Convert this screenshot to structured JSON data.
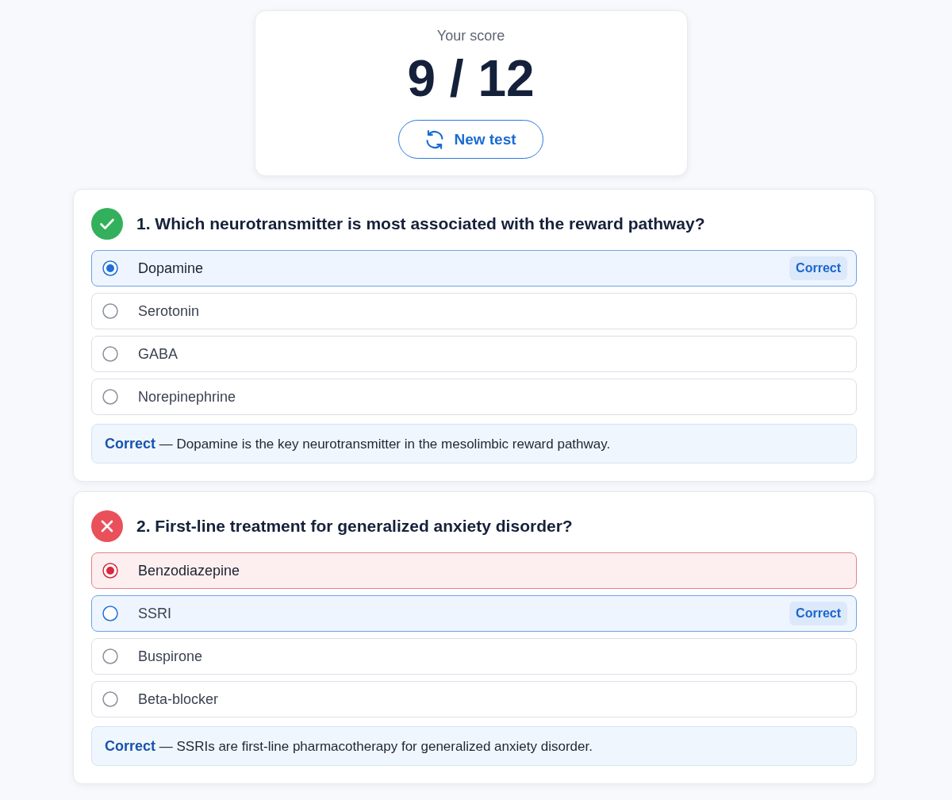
{
  "score": {
    "label": "Your score",
    "value": "9 / 12",
    "button": "New test"
  },
  "questions": [
    {
      "title": "1. Which neurotransmitter is most associated with the reward pathway?",
      "correct": true,
      "options": [
        {
          "label": "Dopamine",
          "selected": true,
          "correct": true,
          "tag": "Correct"
        },
        {
          "label": "Serotonin",
          "selected": false,
          "correct": false
        },
        {
          "label": "GABA",
          "selected": false,
          "correct": false
        },
        {
          "label": "Norepinephrine",
          "selected": false,
          "correct": false
        }
      ],
      "feedback": "**Correct** — Dopamine is the key neurotransmitter in the mesolimbic reward pathway."
    },
    {
      "title": "2. First-line treatment for generalized anxiety disorder?",
      "correct": false,
      "options": [
        {
          "label": "Benzodiazepine",
          "selected": true,
          "correct": false
        },
        {
          "label": "SSRI",
          "selected": false,
          "correct": true,
          "tag": "Correct"
        },
        {
          "label": "Buspirone",
          "selected": false,
          "correct": false
        },
        {
          "label": "Beta-blocker",
          "selected": false,
          "correct": false
        }
      ],
      "feedback": "**Correct** — SSRIs are first-line pharmacotherapy for generalized anxiety disorder."
    }
  ]
}
